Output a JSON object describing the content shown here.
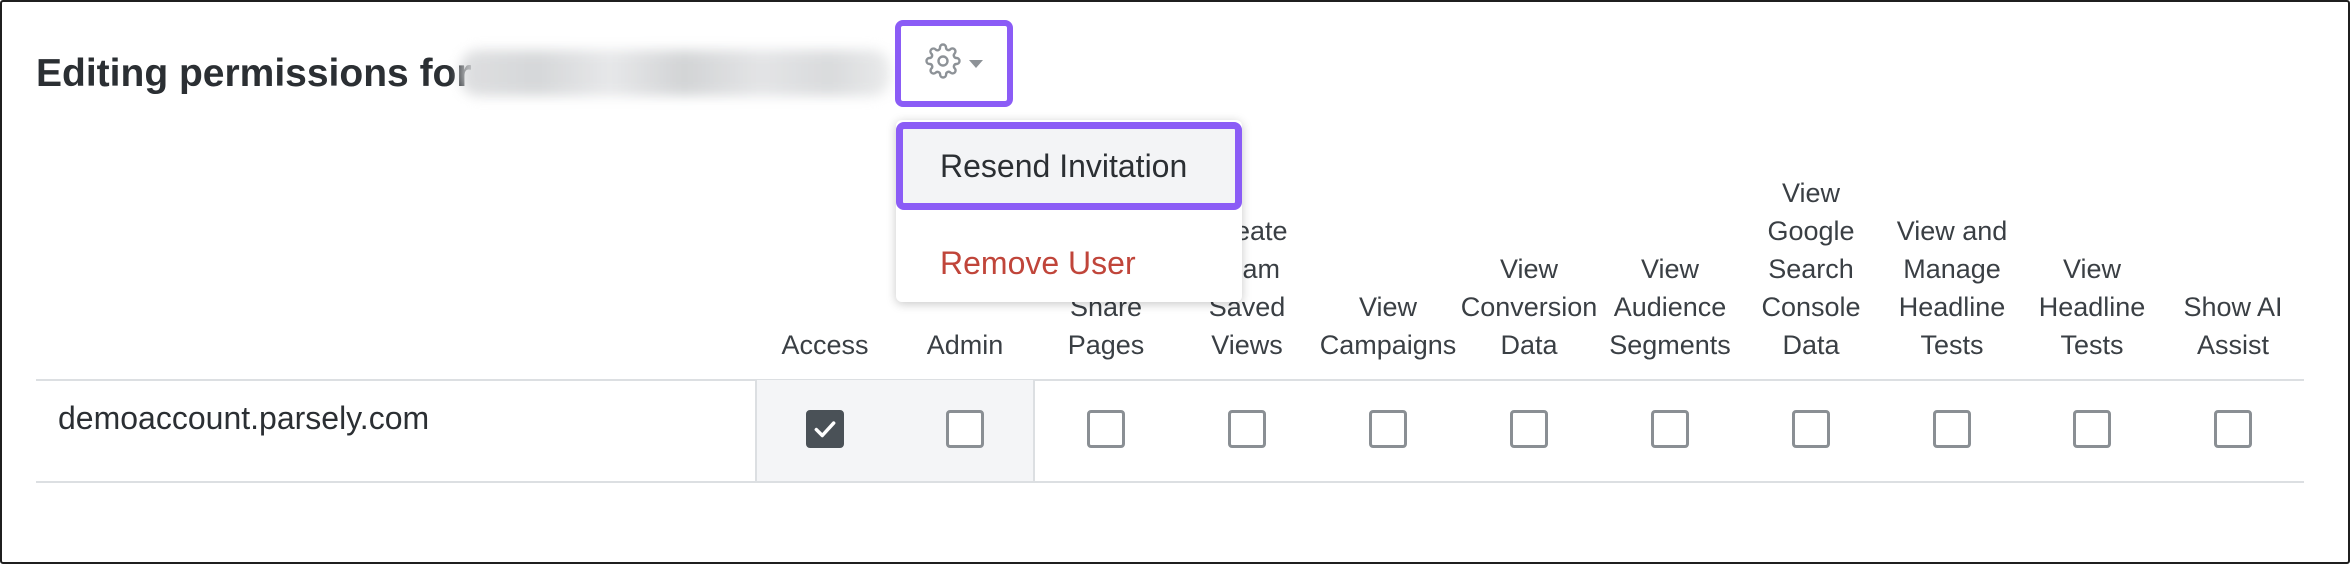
{
  "header": {
    "title": "Editing permissions for",
    "email_placeholder": "redacted-email"
  },
  "settings_menu": {
    "icon": "gear-icon",
    "items": [
      {
        "label": "Resend Invitation"
      },
      {
        "label": "Remove User"
      }
    ]
  },
  "columns": [
    {
      "label": "Access"
    },
    {
      "label": "Admin"
    },
    {
      "label": "Create Share Pages"
    },
    {
      "label": "Create Team Saved Views"
    },
    {
      "label": "View Campaigns"
    },
    {
      "label": "View Conversion Data"
    },
    {
      "label": "View Audience Segments"
    },
    {
      "label": "View Google Search Console Data"
    },
    {
      "label": "View and Manage Headline Tests"
    },
    {
      "label": "View Headline Tests"
    },
    {
      "label": "Show AI Assist"
    }
  ],
  "rows": [
    {
      "site": "demoaccount.parsely.com",
      "checks": [
        true,
        false,
        false,
        false,
        false,
        false,
        false,
        false,
        false,
        false,
        false
      ]
    }
  ],
  "colors": {
    "accent": "#8b5cf6",
    "danger": "#c0453a",
    "checked": "#4a5157"
  }
}
